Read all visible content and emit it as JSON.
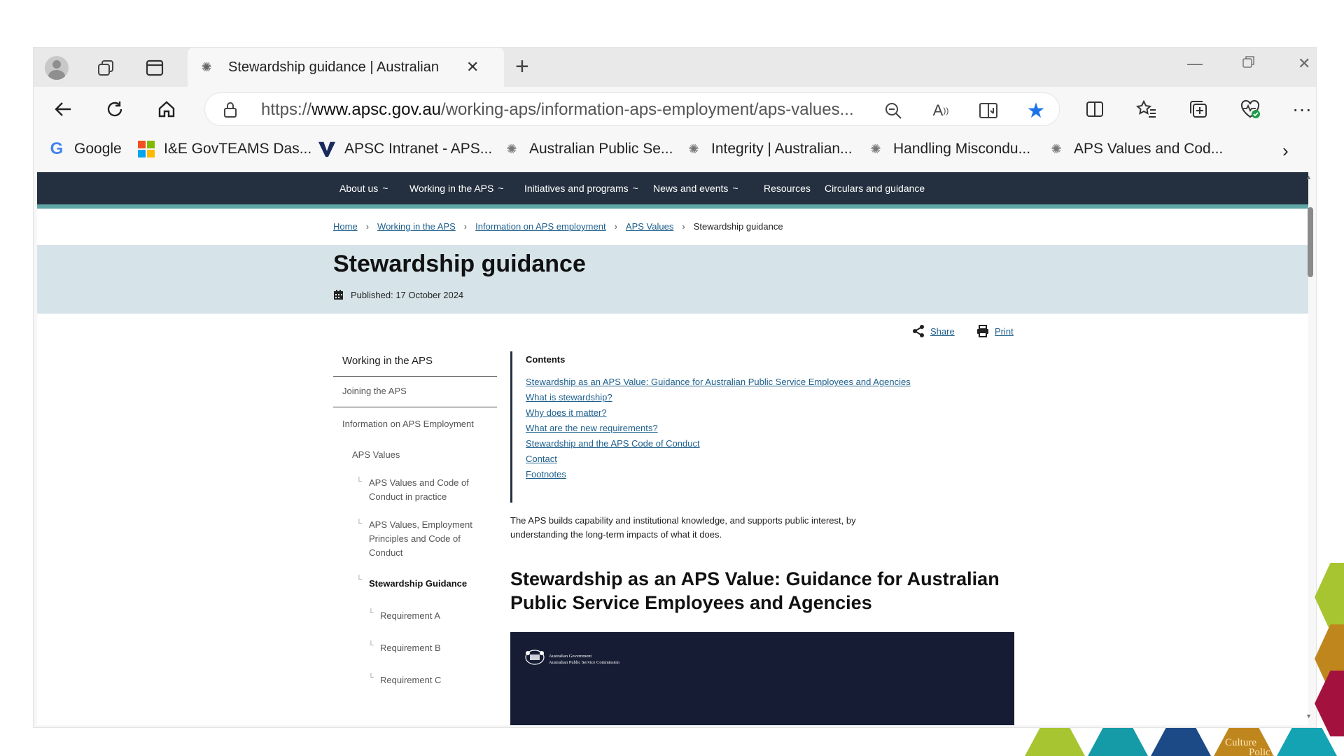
{
  "browser": {
    "tab": {
      "title": "Stewardship guidance | Australian"
    },
    "address": {
      "url_prefix": "https://",
      "url_domain": "www.apsc.gov.au",
      "url_path": "/working-aps/information-aps-employment/aps-values..."
    },
    "bookmarks": [
      {
        "label": "Google",
        "icon": "google-icon"
      },
      {
        "label": "I&E GovTEAMS Das...",
        "icon": "microsoft-icon"
      },
      {
        "label": "APSC Intranet - APS...",
        "icon": "apsc-v-icon"
      },
      {
        "label": "Australian Public Se...",
        "icon": "crest-icon"
      },
      {
        "label": "Integrity | Australian...",
        "icon": "crest-icon"
      },
      {
        "label": "Handling Miscondu...",
        "icon": "crest-icon"
      },
      {
        "label": "APS Values and Cod...",
        "icon": "crest-icon"
      }
    ],
    "colors": {
      "favorite_star": "#1a73e8",
      "health_check": "#1e9e4a"
    }
  },
  "site": {
    "nav": [
      {
        "label": "About us",
        "chevron": "~"
      },
      {
        "label": "Working in the APS",
        "chevron": "~"
      },
      {
        "label": "Initiatives and programs",
        "chevron": "~"
      },
      {
        "label": "News and events",
        "chevron": "~"
      },
      {
        "label": "Resources",
        "chevron": ""
      },
      {
        "label": "Circulars and guidance",
        "chevron": ""
      }
    ],
    "breadcrumb": {
      "items": [
        "Home",
        "Working in the APS",
        "Information on APS employment",
        "APS Values"
      ],
      "separator": "›",
      "current": "Stewardship guidance"
    },
    "page": {
      "title": "Stewardship guidance",
      "published": "Published: 17 October 2024"
    },
    "actions": {
      "share": "Share",
      "print": "Print"
    },
    "sidenav": {
      "top": "Working in the APS",
      "joining": "Joining the APS",
      "info": "Information on APS Employment",
      "aps_values": "APS Values",
      "sub1": "APS Values and Code of Conduct in practice",
      "sub2": "APS Values, Employment Principles and Code of Conduct",
      "sub3": "Stewardship Guidance",
      "req_a": "Requirement A",
      "req_b": "Requirement B",
      "req_c": "Requirement C"
    },
    "contents": {
      "heading": "Contents",
      "links": [
        "Stewardship as an APS Value: Guidance for Australian Public Service Employees and Agencies",
        "What is stewardship?",
        "Why does it matter?",
        "What are the new requirements?",
        "Stewardship and the APS Code of Conduct",
        "Contact",
        "Footnotes"
      ]
    },
    "intro": "The APS builds capability and institutional knowledge, and supports public interest, by understanding the long-term impacts of what it does.",
    "section_heading": "Stewardship as an APS Value: Guidance for Australian Public Service Employees and Agencies",
    "banner": {
      "line1": "Australian Government",
      "line2": "Australian Public Service Commission"
    },
    "colors": {
      "nav_bg": "#24303f",
      "nav_accent": "#5fa7a7",
      "hero_bg": "#d6e4ea",
      "link": "#1d5f8c",
      "banner_bg": "#161c33"
    }
  },
  "decor": {
    "hex_text_1": "Culture",
    "hex_text_2": "Policy"
  }
}
